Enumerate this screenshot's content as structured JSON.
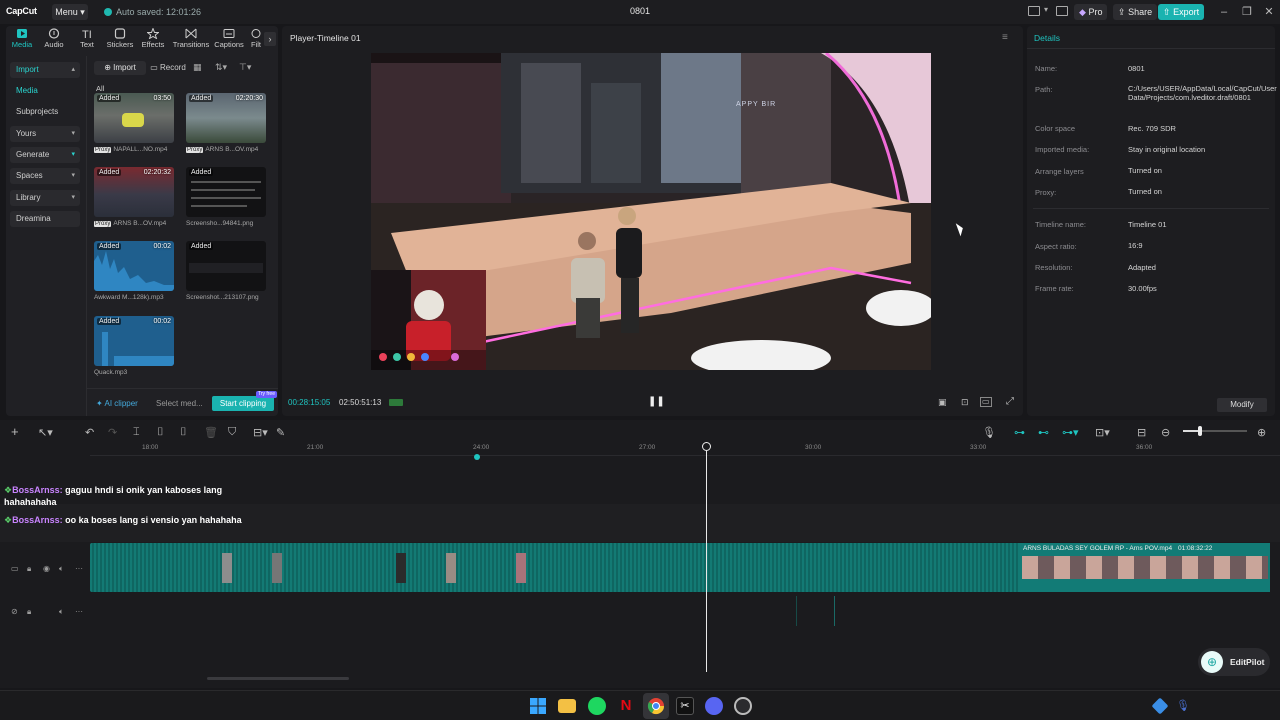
{
  "app": {
    "logo": "CapCut",
    "menu_label": "Menu",
    "autosave": "Auto saved: 12:01:26",
    "project_title": "0801",
    "pro_label": "Pro",
    "share_label": "Share",
    "export_label": "Export"
  },
  "toolbar_tabs": [
    {
      "label": "Media"
    },
    {
      "label": "Audio"
    },
    {
      "label": "Text"
    },
    {
      "label": "Stickers"
    },
    {
      "label": "Effects"
    },
    {
      "label": "Transitions"
    },
    {
      "label": "Captions"
    },
    {
      "label": "Filt"
    }
  ],
  "sidebar": {
    "items": [
      {
        "label": "Import"
      },
      {
        "label": "Media"
      },
      {
        "label": "Subprojects"
      },
      {
        "label": "Yours"
      },
      {
        "label": "Generate"
      },
      {
        "label": "Spaces"
      },
      {
        "label": "Library"
      },
      {
        "label": "Dreamina"
      }
    ]
  },
  "media": {
    "import_label": "Import",
    "record_label": "Record",
    "filter_all": "All",
    "added_badge": "Added",
    "proxy_badge": "Proxy",
    "items": [
      {
        "name": "NAPALL...NO.mp4",
        "duration": "03:50"
      },
      {
        "name": "ARNS B...OV.mp4",
        "duration": "02:20:30"
      },
      {
        "name": "ARNS B...OV.mp4",
        "duration": "02:20:32"
      },
      {
        "name": "Screensho...94841.png",
        "duration": ""
      },
      {
        "name": "Awkward M...128k).mp3",
        "duration": "00:02"
      },
      {
        "name": "Screenshot...213107.png",
        "duration": ""
      },
      {
        "name": "Quack.mp3",
        "duration": "00:02"
      }
    ],
    "ai_clipper": "AI clipper",
    "select_media": "Select med...",
    "start_clipping": "Start clipping",
    "try_free": "Try free"
  },
  "player": {
    "title": "Player-Timeline 01",
    "current_time": "00:28:15:05",
    "total_time": "02:50:51:13",
    "video_sign": "APPY BIR",
    "webcam_overlay": "streamer webcam"
  },
  "details": {
    "title": "Details",
    "rows": [
      {
        "label": "Name:",
        "value": "0801"
      },
      {
        "label": "Path:",
        "value": "C:/Users/USER/AppData/Local/CapCut/User Data/Projects/com.lveditor.draft/0801"
      },
      {
        "label": "Color space",
        "value": "Rec. 709 SDR"
      },
      {
        "label": "Imported media:",
        "value": "Stay in original location"
      },
      {
        "label": "Arrange layers",
        "value": "Turned on"
      },
      {
        "label": "Proxy:",
        "value": "Turned on"
      },
      {
        "label": "Timeline name:",
        "value": "Timeline 01"
      },
      {
        "label": "Aspect ratio:",
        "value": "16:9"
      },
      {
        "label": "Resolution:",
        "value": "Adapted"
      },
      {
        "label": "Frame rate:",
        "value": "30.00fps"
      }
    ],
    "modify_label": "Modify"
  },
  "timeline": {
    "ruler": [
      "18:00",
      "21:00",
      "24:00",
      "27:00",
      "30:00",
      "33:00",
      "36:00"
    ],
    "clip_name": "ARNS BULADAS SEY GOLEM RP - Arns POV.mp4",
    "clip_duration": "01:08:32:22",
    "chat": [
      {
        "user": "BossArnss:",
        "text": "gaguu hndi si onik yan kaboses lang hahahahaha"
      },
      {
        "user": "BossArnss:",
        "text": "oo ka boses lang si vensio yan hahahaha"
      }
    ]
  },
  "editpilot_label": "EditPilot",
  "colors": {
    "accent": "#1fc4c0",
    "clip": "#14807a",
    "export": "#1ab3b0"
  }
}
